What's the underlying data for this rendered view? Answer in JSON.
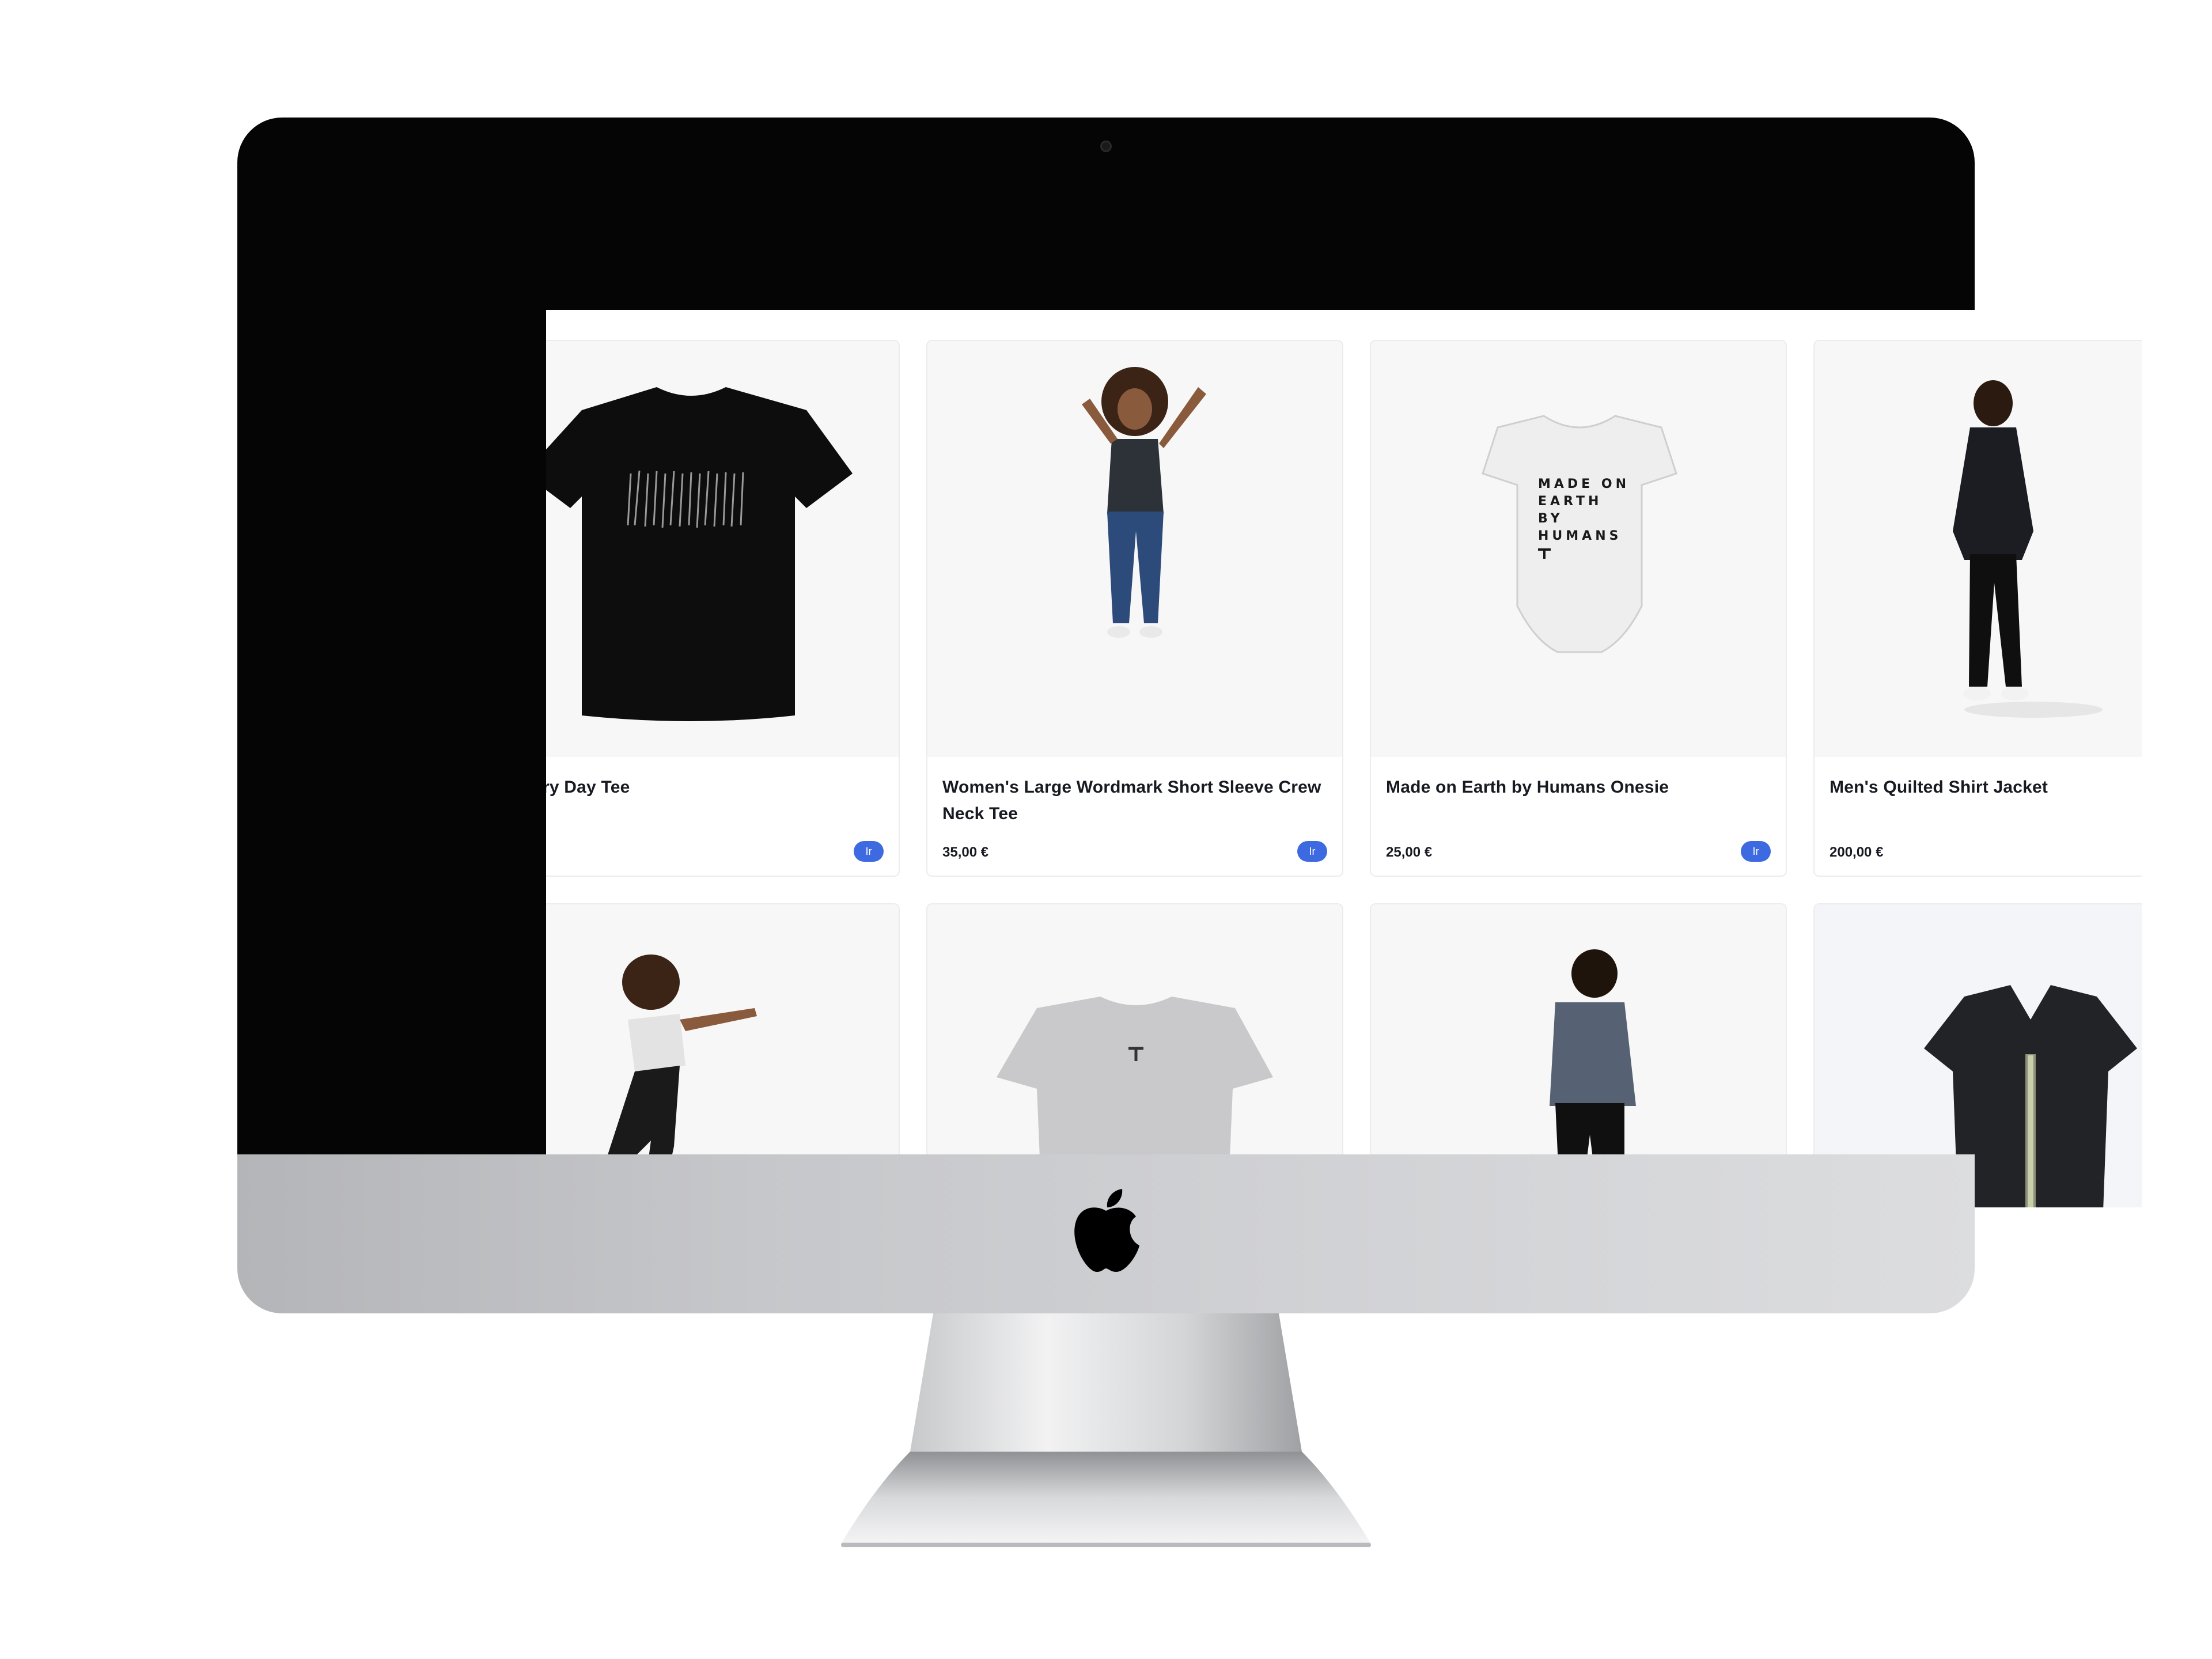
{
  "products": [
    {
      "title": "Battery Day Tee",
      "price": "",
      "button": "Ir"
    },
    {
      "title": "Women's Large Wordmark Short Sleeve Crew Neck Tee",
      "price": "35,00 €",
      "button": "Ir"
    },
    {
      "title": "Made on Earth by Humans Onesie",
      "price": "25,00 €",
      "button": "Ir"
    },
    {
      "title": "Men's Quilted Shirt Jacket",
      "price": "200,00 €",
      "button": ""
    }
  ],
  "onesie_print": [
    "MADE ON",
    "EARTH",
    "BY",
    "HUMANS"
  ],
  "colors": {
    "accent": "#3e6ae1",
    "text": "#171a20",
    "card_bg": "#f7f7f7",
    "bezel": "#050505"
  },
  "icons": {
    "brand": "apple-logo-icon"
  }
}
